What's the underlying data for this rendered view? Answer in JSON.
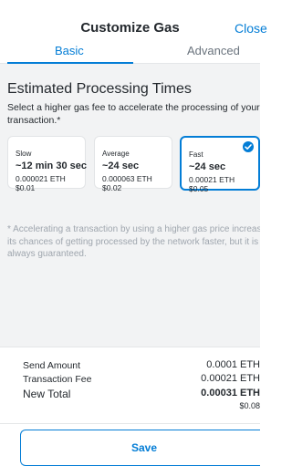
{
  "header": {
    "title": "Customize Gas",
    "close_label": "Close",
    "tabs": [
      {
        "label": "Basic",
        "active": true
      },
      {
        "label": "Advanced",
        "active": false
      }
    ]
  },
  "basic": {
    "heading": "Estimated Processing Times",
    "description": "Select a higher gas fee to accelerate the processing of your transaction.*",
    "options": [
      {
        "label": "Slow",
        "time": "~12 min 30 sec",
        "eth": "0.000021 ETH",
        "usd": "$0.01",
        "selected": false
      },
      {
        "label": "Average",
        "time": "~24 sec",
        "eth": "0.000063 ETH",
        "usd": "$0.02",
        "selected": false
      },
      {
        "label": "Fast",
        "time": "~24 sec",
        "eth": "0.00021 ETH",
        "usd": "$0.05",
        "selected": true
      }
    ],
    "note": "* Accelerating a transaction by using a higher gas price increases its chances of getting processed by the network faster, but it is not always guaranteed."
  },
  "totals": {
    "send_amount_label": "Send Amount",
    "send_amount_value": "0.0001 ETH",
    "fee_label": "Transaction Fee",
    "fee_value": "0.00021 ETH",
    "new_total_label": "New Total",
    "new_total_value": "0.00031 ETH",
    "new_total_usd": "$0.08"
  },
  "footer": {
    "save_label": "Save"
  },
  "colors": {
    "accent": "#037dd6",
    "panel_background": "#f2f3f4",
    "note_text": "#9fa6ae"
  }
}
